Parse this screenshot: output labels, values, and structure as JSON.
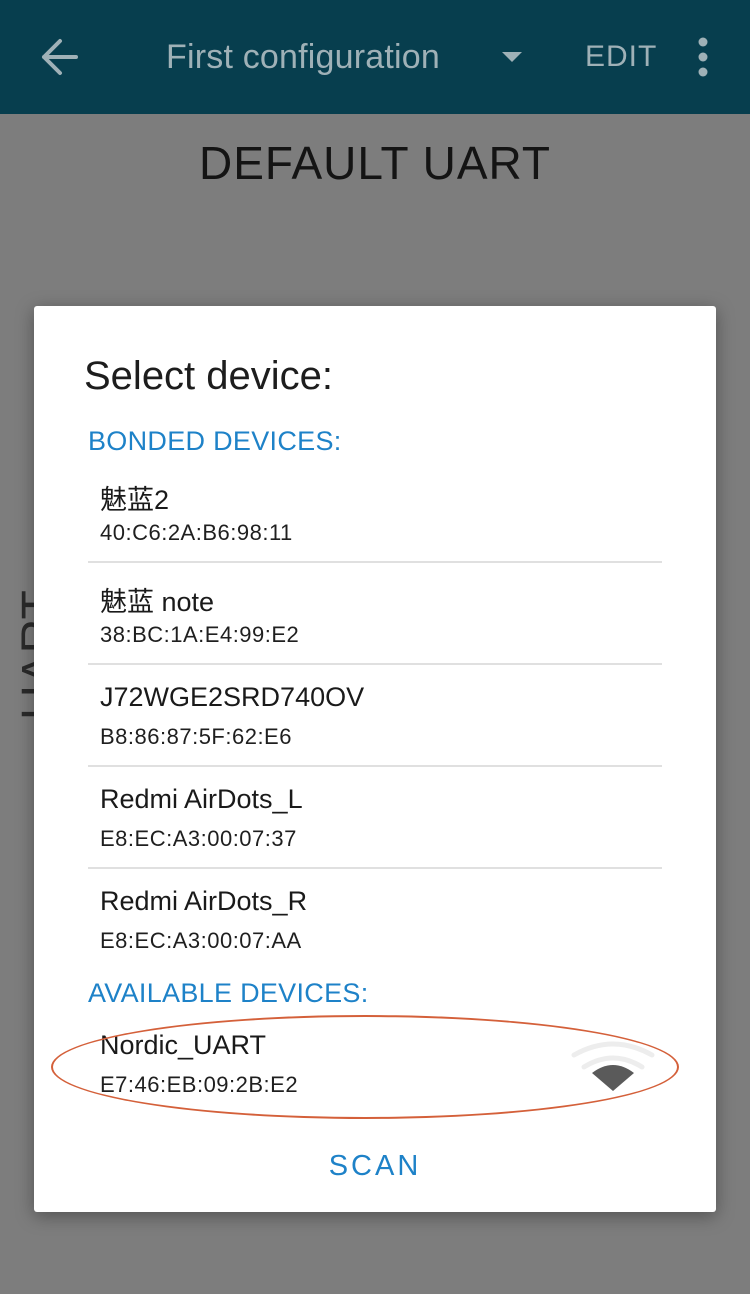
{
  "appbar": {
    "title": "First configuration",
    "edit_label": "EDIT",
    "icons": [
      "arrow-back-icon",
      "dropdown-triangle-icon",
      "more-vert-icon"
    ]
  },
  "page": {
    "heading": "DEFAULT UART",
    "vertical_label": "UART"
  },
  "dialog": {
    "title": "Select device:",
    "bonded_header": "BONDED DEVICES:",
    "bonded": [
      {
        "name": "魅蓝2",
        "address": "40:C6:2A:B6:98:11"
      },
      {
        "name": "魅蓝 note",
        "address": "38:BC:1A:E4:99:E2"
      },
      {
        "name": "J72WGE2SRD740OV",
        "address": "B8:86:87:5F:62:E6"
      },
      {
        "name": "Redmi AirDots_L",
        "address": "E8:EC:A3:00:07:37"
      },
      {
        "name": "Redmi AirDots_R",
        "address": "E8:EC:A3:00:07:AA"
      }
    ],
    "available_header": "AVAILABLE DEVICES:",
    "available": [
      {
        "name": "Nordic_UART",
        "address": "E7:46:EB:09:2B:E2",
        "signal_icon": "signal-strength-icon"
      }
    ],
    "scan_label": "SCAN"
  },
  "colors": {
    "appbar": "#073e4e",
    "accent": "#1e82c8",
    "annotation": "#d4603a",
    "scrim": "#7d7d7d"
  }
}
